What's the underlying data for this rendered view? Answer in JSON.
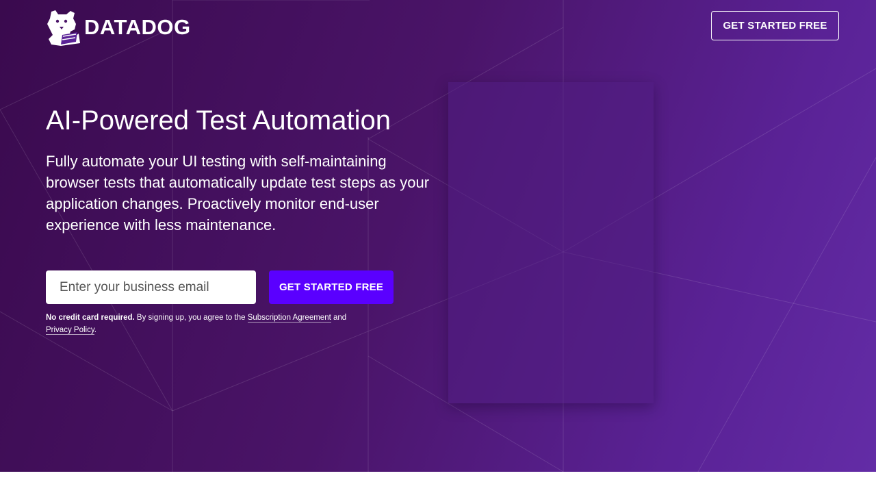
{
  "header": {
    "logo_text": "DATADOG",
    "logo_icon": "datadog-bits-dog-icon",
    "cta_label": "GET STARTED FREE"
  },
  "hero": {
    "title": "AI-Powered Test Automation",
    "description": "Fully automate your UI testing with self-maintaining browser tests that automatically update test steps as your application changes. Proactively monitor end-user experience with less maintenance.",
    "email_placeholder": "Enter your business email",
    "email_value": "",
    "cta_label": "GET STARTED FREE",
    "disclaimer": {
      "bold": "No credit card required.",
      "text_before_link": " By signing up, you agree to the ",
      "subscription_link": "Subscription Agreement",
      "text_between": " and ",
      "privacy_link": "Privacy Policy",
      "text_end": "."
    }
  },
  "colors": {
    "background_start": "#3a0a4e",
    "background_end": "#632ca6",
    "primary_button": "#5a00ff",
    "text": "#ffffff"
  }
}
